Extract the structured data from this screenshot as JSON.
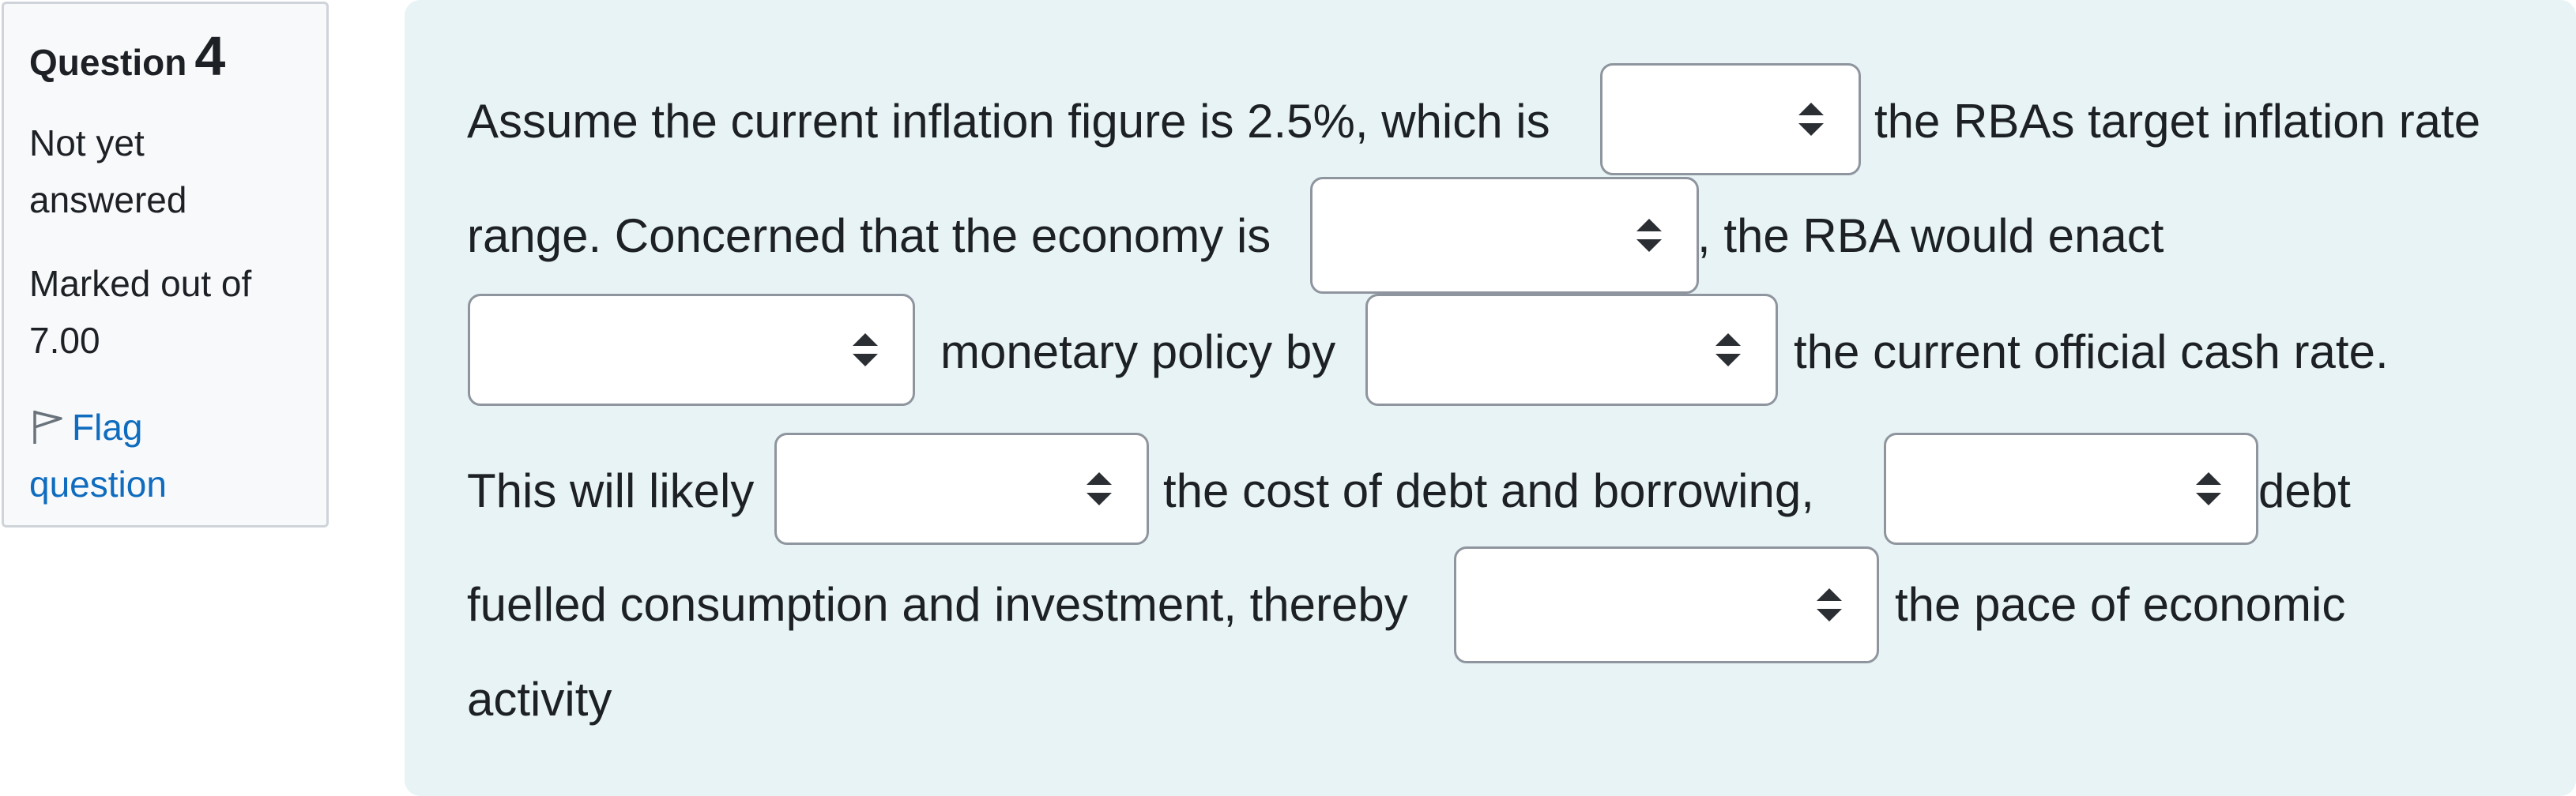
{
  "question_info": {
    "label": "Question",
    "number": "4",
    "state_line1": "Not yet",
    "state_line2": "answered",
    "grade_line1": "Marked out of",
    "grade_line2": "7.00",
    "flag_line1": "Flag",
    "flag_line2": "question",
    "flag_icon": "flag-outline-icon",
    "link_color": "#0f6cbf"
  },
  "question_text": {
    "seg_01": "Assume the current inflation figure is 2.5%, which is",
    "seg_02": "the RBAs target inflation rate",
    "seg_03": "range. Concerned that the economy is",
    "seg_04": ", the RBA would enact",
    "seg_05": "monetary policy by",
    "seg_06": "the current official cash rate.",
    "seg_07": "This will likely",
    "seg_08": "the cost of debt and borrowing,",
    "seg_09": "debt",
    "seg_10": "fuelled consumption and investment, thereby",
    "seg_11": "the pace of economic",
    "seg_12": "activity"
  },
  "dropdowns": [
    {
      "id": "1",
      "selected": ""
    },
    {
      "id": "2",
      "selected": ""
    },
    {
      "id": "3",
      "selected": ""
    },
    {
      "id": "4",
      "selected": ""
    },
    {
      "id": "5",
      "selected": ""
    },
    {
      "id": "6",
      "selected": ""
    },
    {
      "id": "7",
      "selected": ""
    }
  ],
  "colors": {
    "content_bg": "#e7f3f5",
    "info_bg": "#f8f9fa",
    "text": "#1d2125"
  }
}
